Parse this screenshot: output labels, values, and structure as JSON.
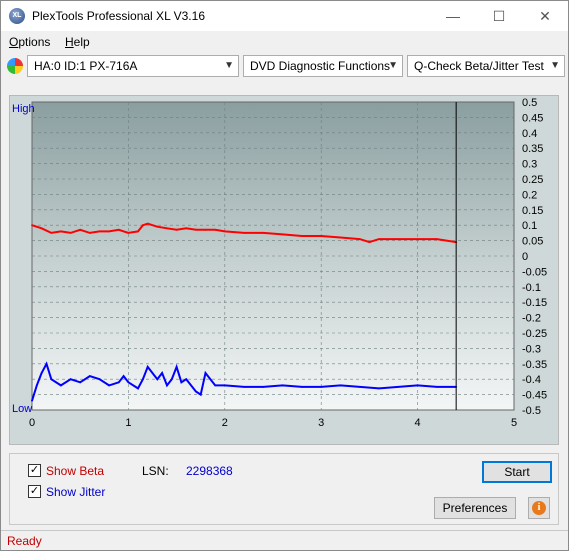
{
  "window": {
    "title": "PlexTools Professional XL V3.16",
    "icon_text": "XL",
    "min_glyph": "—",
    "max_glyph": "☐",
    "close_glyph": "✕"
  },
  "menu": {
    "options_label": "Options",
    "options_hotkey": "O",
    "options_rest": "ptions",
    "help_label": "Help",
    "help_hotkey": "H",
    "help_rest": "elp"
  },
  "toolbar": {
    "drive_value": "HA:0 ID:1  PX-716A",
    "function_value": "DVD Diagnostic Functions",
    "test_value": "Q-Check Beta/Jitter Test"
  },
  "chart_data": {
    "type": "line",
    "y_left_labels": [
      "High",
      "Low"
    ],
    "y_right_ticks": [
      "0.5",
      "0.45",
      "0.4",
      "0.35",
      "0.3",
      "0.25",
      "0.2",
      "0.15",
      "0.1",
      "0.05",
      "0",
      "-0.05",
      "-0.1",
      "-0.15",
      "-0.2",
      "-0.25",
      "-0.3",
      "-0.35",
      "-0.4",
      "-0.45",
      "-0.5"
    ],
    "x_ticks": [
      "0",
      "1",
      "2",
      "3",
      "4",
      "5"
    ],
    "xlim": [
      0,
      5
    ],
    "ylim": [
      -0.5,
      0.5
    ],
    "end_marker_x": 4.4,
    "series": [
      {
        "name": "Beta",
        "color": "#ff0000",
        "x": [
          0,
          0.1,
          0.2,
          0.3,
          0.4,
          0.5,
          0.6,
          0.7,
          0.8,
          0.9,
          1.0,
          1.1,
          1.15,
          1.2,
          1.3,
          1.4,
          1.5,
          1.6,
          1.7,
          1.8,
          1.9,
          2.0,
          2.2,
          2.4,
          2.6,
          2.8,
          3.0,
          3.2,
          3.4,
          3.5,
          3.6,
          3.8,
          4.0,
          4.2,
          4.4
        ],
        "y": [
          0.1,
          0.09,
          0.075,
          0.08,
          0.075,
          0.085,
          0.075,
          0.08,
          0.08,
          0.085,
          0.075,
          0.08,
          0.1,
          0.105,
          0.095,
          0.09,
          0.085,
          0.09,
          0.085,
          0.085,
          0.085,
          0.08,
          0.075,
          0.075,
          0.07,
          0.065,
          0.065,
          0.06,
          0.055,
          0.045,
          0.055,
          0.055,
          0.055,
          0.055,
          0.045
        ]
      },
      {
        "name": "Jitter",
        "color": "#0000ff",
        "x": [
          0,
          0.05,
          0.1,
          0.15,
          0.2,
          0.3,
          0.4,
          0.5,
          0.6,
          0.7,
          0.8,
          0.9,
          0.95,
          1.0,
          1.1,
          1.15,
          1.2,
          1.3,
          1.35,
          1.4,
          1.45,
          1.5,
          1.55,
          1.6,
          1.7,
          1.75,
          1.8,
          1.9,
          2.0,
          2.2,
          2.4,
          2.6,
          2.8,
          3.0,
          3.2,
          3.4,
          3.6,
          3.8,
          4.0,
          4.2,
          4.4
        ],
        "y": [
          -0.47,
          -0.42,
          -0.38,
          -0.35,
          -0.4,
          -0.42,
          -0.4,
          -0.41,
          -0.39,
          -0.4,
          -0.42,
          -0.41,
          -0.39,
          -0.41,
          -0.43,
          -0.4,
          -0.36,
          -0.4,
          -0.38,
          -0.42,
          -0.4,
          -0.36,
          -0.41,
          -0.4,
          -0.44,
          -0.45,
          -0.38,
          -0.42,
          -0.42,
          -0.425,
          -0.425,
          -0.42,
          -0.425,
          -0.425,
          -0.42,
          -0.425,
          -0.43,
          -0.425,
          -0.42,
          -0.425,
          -0.425
        ]
      }
    ]
  },
  "controls": {
    "show_beta_label": "Show Beta",
    "show_beta_check": "✓",
    "show_jitter_label": "Show Jitter",
    "show_jitter_check": "✓",
    "lsn_label": "LSN:",
    "lsn_value": "2298368",
    "start_label": "Start",
    "preferences_label": "Preferences",
    "info_glyph": "i"
  },
  "status": {
    "text": "Ready"
  },
  "colors": {
    "beta": "#ff0000",
    "jitter": "#0000ff",
    "status_text": "#c00000",
    "axis_label": "#0000cc"
  }
}
